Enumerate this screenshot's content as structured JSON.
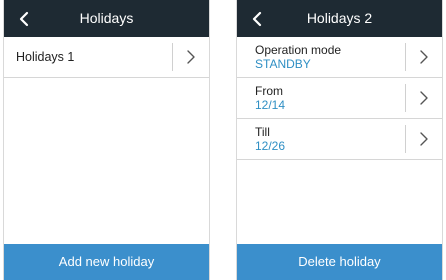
{
  "left_screen": {
    "title": "Holidays",
    "items": [
      {
        "label": "Holidays 1"
      }
    ],
    "footer_button": "Add new holiday"
  },
  "right_screen": {
    "title": "Holidays 2",
    "fields": [
      {
        "label": "Operation mode",
        "value": "STANDBY"
      },
      {
        "label": "From",
        "value": "12/14"
      },
      {
        "label": "Till",
        "value": "12/26"
      }
    ],
    "footer_button": "Delete holiday"
  },
  "colors": {
    "header_bg": "#1e2a33",
    "accent": "#3b8fcc",
    "value_text": "#2f8fc4"
  },
  "icons": {
    "back": "chevron-left-icon",
    "row_arrow": "chevron-right-icon"
  }
}
